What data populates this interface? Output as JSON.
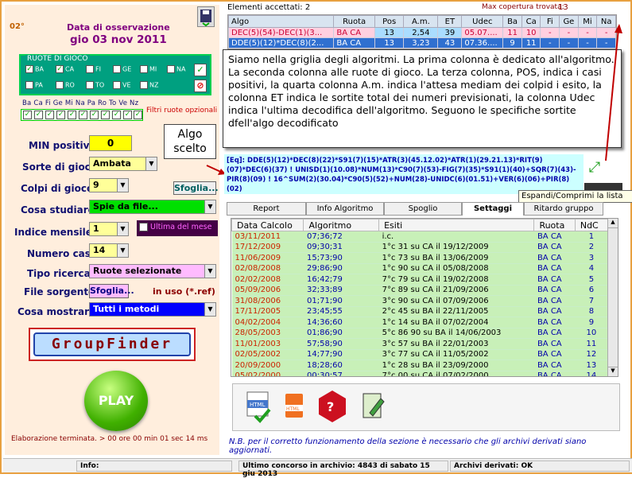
{
  "left": {
    "date_prefix": "02°",
    "date_title": "Data di osservazione",
    "date_value": "gio 03 nov 2011",
    "ruote_title": "RUOTE DI GIOCO",
    "ruote_row1": [
      "BA",
      "CA",
      "FI",
      "GE",
      "MI",
      "NA"
    ],
    "ruote_row2": [
      "PA",
      "RO",
      "TO",
      "VE",
      "NZ"
    ],
    "filter_labels": [
      "Ba",
      "Ca",
      "Fi",
      "Ge",
      "Mi",
      "Na",
      "Pa",
      "Ro",
      "To",
      "Ve",
      "Nz"
    ],
    "filter_link": "Filtri ruote opzionali",
    "min_pos_label": "MIN positivi:",
    "min_pos_value": "0",
    "sorte_label": "Sorte di gioco:",
    "sorte_value": "Ambata",
    "colpi_label": "Colpi di gioco:",
    "colpi_value": "9",
    "sfoglia1": "Sfoglia...",
    "cosa_label": "Cosa studiare:",
    "cosa_value": "Spie da file...",
    "indice_label": "Indice mensile:",
    "indice_value": "1",
    "ultima_label": "Ultima del mese",
    "numero_label": "Numero casi:",
    "numero_value": "14",
    "tipo_label": "Tipo ricerca:",
    "tipo_value": "Ruote selezionate",
    "file_label": "File sorgente:",
    "sfoglia2": "Sfoglia...",
    "in_uso": "in uso (*.ref)",
    "mostrare_label": "Cosa mostrare:",
    "mostrare_value": "Tutti i metodi",
    "logo": "GroupFinder",
    "play": "PLAY",
    "elaborazione": "Elaborazione terminata. > 00 ore 00 min 01 sec 14 ms"
  },
  "grid": {
    "accettati": "Elementi accettati: 2",
    "copertura_label": "Max copertura trovata:",
    "copertura_value": "13",
    "headers": [
      "Algo",
      "Ruota",
      "Pos",
      "A.m.",
      "ET",
      "Udec",
      "Ba",
      "Ca",
      "Fi",
      "Ge",
      "Mi",
      "Na"
    ],
    "rows": [
      [
        "DEC(5)(54)-DEC(1)(3...",
        "BA CA",
        "13",
        "2,54",
        "39",
        "05.07....",
        "11",
        "10",
        "-",
        "-",
        "-",
        "-"
      ],
      [
        "DDE(5)(12)*DEC(8)(2...",
        "BA CA",
        "13",
        "3,23",
        "43",
        "07.36....",
        "9",
        "11",
        "-",
        "-",
        "-",
        "-"
      ]
    ]
  },
  "tooltip": "Siamo nella griglia degli algoritmi. La prima colonna è dedicato all'algoritmo. La seconda colonna alle ruote di gioco. La terza colonna, POS, indica i casi positivi, la quarta colonna A.m. indica l'attesa mediam dei colpid i esito, la colonna ET indica le sortite total dei numeri previsionati, la colonna Udec indica l'ultima decodifica dell'algoritmo. Seguono le specifiche sortite dfell'algo decodificato",
  "algo_callout": "Algo scelto",
  "equation": "[Eq]: DDE(5)(12)*DEC(8)(22)*S91(7)(15)*ATR(3)(45.12.02)*ATR(1)(29.21.13)*RIT(9)(07)*DEC(6)(37) ! UNISD(1)(10.08)*NUM(13)*C90(7)(53)-FIG(7)(35)*S91(1)(40)+SQR(7)(43)-PIR(8)(09) ! 16^SUM(2)(30.04)*C90(5)(52)+NUM(28)-UNIDC(6)(01.51)+VER(6)(06)+PIR(8)(02)",
  "espandi": "Espandi/Comprimi la lista",
  "tabs": [
    "Report",
    "Info Algoritmo",
    "Spoglio",
    "Settaggi",
    "Ritardo gruppo"
  ],
  "calc": {
    "headers": [
      "Data Calcolo",
      "Algoritmo",
      "Esiti",
      "Ruota",
      "NdC"
    ],
    "rows": [
      [
        "03/11/2011",
        "07;36;72",
        "i.c.",
        "BA CA",
        "1"
      ],
      [
        "17/12/2009",
        "09;30;31",
        "1°c 31 su CA il 19/12/2009",
        "BA CA",
        "2"
      ],
      [
        "11/06/2009",
        "15;73;90",
        "1°c 73 su BA il 13/06/2009",
        "BA CA",
        "3"
      ],
      [
        "02/08/2008",
        "29;86;90",
        "1°c 90 su CA il 05/08/2008",
        "BA CA",
        "4"
      ],
      [
        "02/02/2008",
        "16;42;79",
        "7°c 79 su CA il 19/02/2008",
        "BA CA",
        "5"
      ],
      [
        "05/09/2006",
        "32;33;89",
        "7°c 89 su CA il 21/09/2006",
        "BA CA",
        "6"
      ],
      [
        "31/08/2006",
        "01;71;90",
        "3°c 90 su CA il 07/09/2006",
        "BA CA",
        "7"
      ],
      [
        "17/11/2005",
        "23;45;55",
        "2°c 45 su BA il 22/11/2005",
        "BA CA",
        "8"
      ],
      [
        "04/02/2004",
        "14;36;60",
        "1°c 14 su BA il 07/02/2004",
        "BA CA",
        "9"
      ],
      [
        "28/05/2003",
        "01;86;90",
        "5°c 86 90 su BA il 14/06/2003",
        "BA CA",
        "10"
      ],
      [
        "11/01/2003",
        "57;58;90",
        "3°c 57 su BA il 22/01/2003",
        "BA CA",
        "11"
      ],
      [
        "02/05/2002",
        "14;77;90",
        "3°c 77 su CA il 11/05/2002",
        "BA CA",
        "12"
      ],
      [
        "20/09/2000",
        "18;28;60",
        "1°c 28 su BA il 23/09/2000",
        "BA CA",
        "13"
      ],
      [
        "05/02/2000",
        "00;30;57",
        "7°c 00 su CA il 07/02/2000",
        "BA CA",
        "14"
      ]
    ]
  },
  "note": "N.B. per il corretto funzionamento della sezione è necessario che gli archivi derivati siano aggiornati.",
  "status": {
    "info": "Info:",
    "concorso": "Ultimo concorso in archivio: 4843 di sabato 15 giu 2013",
    "archivi": "Archivi derivati: OK"
  },
  "colors": {
    "accent_border": "#e8a040",
    "left_bg": "#ffeedd",
    "ruote_bg": "#00a080",
    "row_green": "#c8f0b8",
    "date_red": "#cc2200",
    "header_blue": "#101070"
  }
}
